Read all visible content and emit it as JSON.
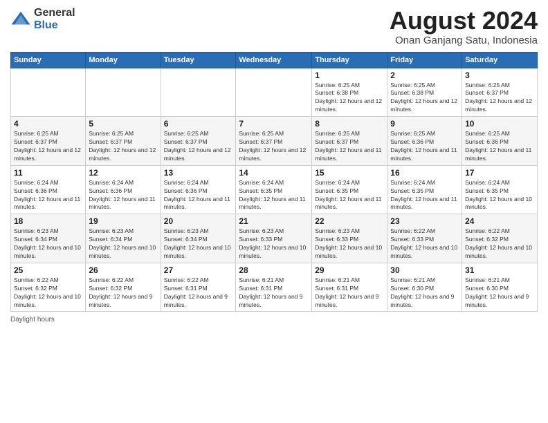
{
  "logo": {
    "general": "General",
    "blue": "Blue"
  },
  "header": {
    "title": "August 2024",
    "subtitle": "Onan Ganjang Satu, Indonesia"
  },
  "days_of_week": [
    "Sunday",
    "Monday",
    "Tuesday",
    "Wednesday",
    "Thursday",
    "Friday",
    "Saturday"
  ],
  "weeks": [
    [
      {
        "day": "",
        "info": ""
      },
      {
        "day": "",
        "info": ""
      },
      {
        "day": "",
        "info": ""
      },
      {
        "day": "",
        "info": ""
      },
      {
        "day": "1",
        "info": "Sunrise: 6:25 AM\nSunset: 6:38 PM\nDaylight: 12 hours and 12 minutes."
      },
      {
        "day": "2",
        "info": "Sunrise: 6:25 AM\nSunset: 6:38 PM\nDaylight: 12 hours and 12 minutes."
      },
      {
        "day": "3",
        "info": "Sunrise: 6:25 AM\nSunset: 6:37 PM\nDaylight: 12 hours and 12 minutes."
      }
    ],
    [
      {
        "day": "4",
        "info": "Sunrise: 6:25 AM\nSunset: 6:37 PM\nDaylight: 12 hours and 12 minutes."
      },
      {
        "day": "5",
        "info": "Sunrise: 6:25 AM\nSunset: 6:37 PM\nDaylight: 12 hours and 12 minutes."
      },
      {
        "day": "6",
        "info": "Sunrise: 6:25 AM\nSunset: 6:37 PM\nDaylight: 12 hours and 12 minutes."
      },
      {
        "day": "7",
        "info": "Sunrise: 6:25 AM\nSunset: 6:37 PM\nDaylight: 12 hours and 12 minutes."
      },
      {
        "day": "8",
        "info": "Sunrise: 6:25 AM\nSunset: 6:37 PM\nDaylight: 12 hours and 11 minutes."
      },
      {
        "day": "9",
        "info": "Sunrise: 6:25 AM\nSunset: 6:36 PM\nDaylight: 12 hours and 11 minutes."
      },
      {
        "day": "10",
        "info": "Sunrise: 6:25 AM\nSunset: 6:36 PM\nDaylight: 12 hours and 11 minutes."
      }
    ],
    [
      {
        "day": "11",
        "info": "Sunrise: 6:24 AM\nSunset: 6:36 PM\nDaylight: 12 hours and 11 minutes."
      },
      {
        "day": "12",
        "info": "Sunrise: 6:24 AM\nSunset: 6:36 PM\nDaylight: 12 hours and 11 minutes."
      },
      {
        "day": "13",
        "info": "Sunrise: 6:24 AM\nSunset: 6:36 PM\nDaylight: 12 hours and 11 minutes."
      },
      {
        "day": "14",
        "info": "Sunrise: 6:24 AM\nSunset: 6:35 PM\nDaylight: 12 hours and 11 minutes."
      },
      {
        "day": "15",
        "info": "Sunrise: 6:24 AM\nSunset: 6:35 PM\nDaylight: 12 hours and 11 minutes."
      },
      {
        "day": "16",
        "info": "Sunrise: 6:24 AM\nSunset: 6:35 PM\nDaylight: 12 hours and 11 minutes."
      },
      {
        "day": "17",
        "info": "Sunrise: 6:24 AM\nSunset: 6:35 PM\nDaylight: 12 hours and 10 minutes."
      }
    ],
    [
      {
        "day": "18",
        "info": "Sunrise: 6:23 AM\nSunset: 6:34 PM\nDaylight: 12 hours and 10 minutes."
      },
      {
        "day": "19",
        "info": "Sunrise: 6:23 AM\nSunset: 6:34 PM\nDaylight: 12 hours and 10 minutes."
      },
      {
        "day": "20",
        "info": "Sunrise: 6:23 AM\nSunset: 6:34 PM\nDaylight: 12 hours and 10 minutes."
      },
      {
        "day": "21",
        "info": "Sunrise: 6:23 AM\nSunset: 6:33 PM\nDaylight: 12 hours and 10 minutes."
      },
      {
        "day": "22",
        "info": "Sunrise: 6:23 AM\nSunset: 6:33 PM\nDaylight: 12 hours and 10 minutes."
      },
      {
        "day": "23",
        "info": "Sunrise: 6:22 AM\nSunset: 6:33 PM\nDaylight: 12 hours and 10 minutes."
      },
      {
        "day": "24",
        "info": "Sunrise: 6:22 AM\nSunset: 6:32 PM\nDaylight: 12 hours and 10 minutes."
      }
    ],
    [
      {
        "day": "25",
        "info": "Sunrise: 6:22 AM\nSunset: 6:32 PM\nDaylight: 12 hours and 10 minutes."
      },
      {
        "day": "26",
        "info": "Sunrise: 6:22 AM\nSunset: 6:32 PM\nDaylight: 12 hours and 9 minutes."
      },
      {
        "day": "27",
        "info": "Sunrise: 6:22 AM\nSunset: 6:31 PM\nDaylight: 12 hours and 9 minutes."
      },
      {
        "day": "28",
        "info": "Sunrise: 6:21 AM\nSunset: 6:31 PM\nDaylight: 12 hours and 9 minutes."
      },
      {
        "day": "29",
        "info": "Sunrise: 6:21 AM\nSunset: 6:31 PM\nDaylight: 12 hours and 9 minutes."
      },
      {
        "day": "30",
        "info": "Sunrise: 6:21 AM\nSunset: 6:30 PM\nDaylight: 12 hours and 9 minutes."
      },
      {
        "day": "31",
        "info": "Sunrise: 6:21 AM\nSunset: 6:30 PM\nDaylight: 12 hours and 9 minutes."
      }
    ]
  ],
  "footer": {
    "daylight_label": "Daylight hours"
  }
}
